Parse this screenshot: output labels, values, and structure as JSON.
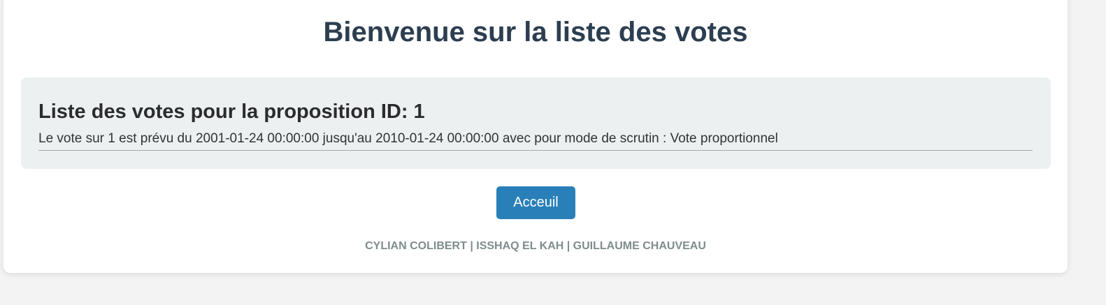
{
  "page": {
    "title": "Bienvenue sur la liste des votes"
  },
  "vote": {
    "heading": "Liste des votes pour la proposition ID: 1",
    "description": "Le vote sur 1 est prévu du 2001-01-24 00:00:00 jusqu'au 2010-01-24 00:00:00 avec pour mode de scrutin : Vote proportionnel"
  },
  "actions": {
    "home_label": "Acceuil"
  },
  "footer": {
    "credits": "CYLIAN COLIBERT | ISSHAQ EL KAH | GUILLAUME CHAUVEAU"
  },
  "colors": {
    "title": "#2c3e50",
    "panel_background": "#ecf0f1",
    "button_background": "#2980b9",
    "footer_text": "#7f8c8d"
  }
}
